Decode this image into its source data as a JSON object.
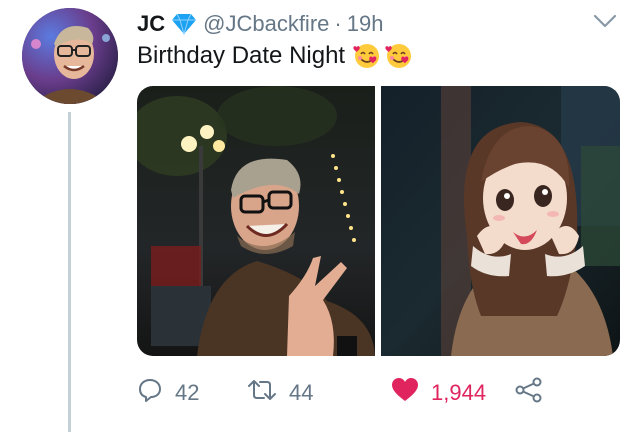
{
  "tweet": {
    "author_name": "JC",
    "handle": "@JCbackfire",
    "separator": "·",
    "time": "19h",
    "text": "Birthday Date Night"
  },
  "icons": {
    "verified": "diamond-icon",
    "menu": "chevron-down-icon",
    "emoji": "smiling-face-with-hearts-emoji",
    "reply": "reply-icon",
    "retweet": "retweet-icon",
    "like": "heart-icon",
    "share": "share-icon"
  },
  "stats": {
    "replies": "42",
    "retweets": "44",
    "likes": "1,944"
  },
  "colors": {
    "like": "#e0245e",
    "verified": "#1da1f2",
    "muted": "#657786"
  }
}
